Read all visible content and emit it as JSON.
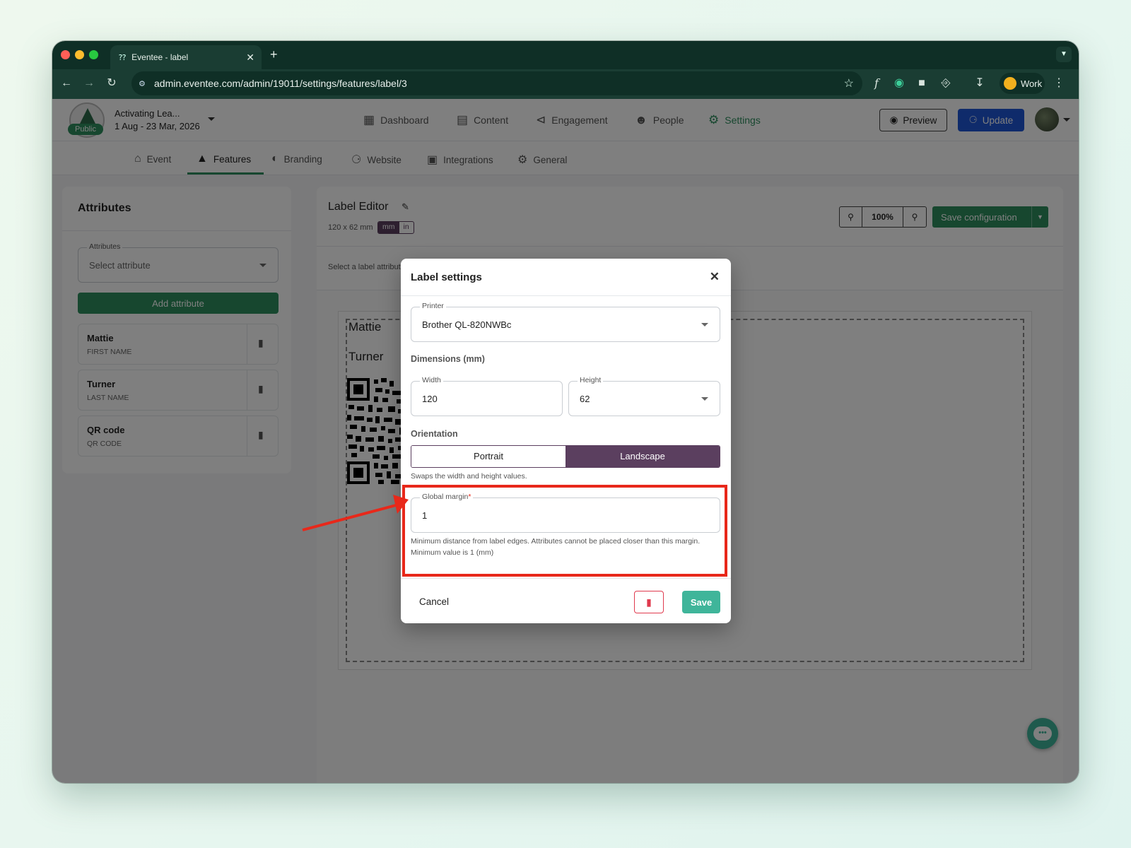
{
  "browser": {
    "tab_title": "Eventee - label",
    "url": "admin.eventee.com/admin/19011/settings/features/label/3",
    "profile_label": "Work"
  },
  "event": {
    "name": "Activating Lea...",
    "dates": "1 Aug - 23 Mar, 2026",
    "status_badge": "Public"
  },
  "main_nav": {
    "items": [
      {
        "label": "Dashboard",
        "icon": "dashboard-icon"
      },
      {
        "label": "Content",
        "icon": "calendar-icon"
      },
      {
        "label": "Engagement",
        "icon": "share-icon"
      },
      {
        "label": "People",
        "icon": "people-icon"
      },
      {
        "label": "Settings",
        "icon": "gear-icon",
        "active": true
      }
    ],
    "preview_label": "Preview",
    "update_label": "Update"
  },
  "sub_nav": {
    "items": [
      {
        "label": "Event",
        "icon": "home-icon"
      },
      {
        "label": "Features",
        "icon": "rocket-icon",
        "active": true
      },
      {
        "label": "Branding",
        "icon": "palette-icon"
      },
      {
        "label": "Website",
        "icon": "globe-icon"
      },
      {
        "label": "Integrations",
        "icon": "puzzle-icon"
      },
      {
        "label": "General",
        "icon": "gears-icon"
      }
    ]
  },
  "attributes_panel": {
    "title": "Attributes",
    "select_label": "Attributes",
    "select_placeholder": "Select attribute",
    "add_button": "Add attribute",
    "items": [
      {
        "name": "Mattie",
        "type": "FIRST NAME"
      },
      {
        "name": "Turner",
        "type": "LAST NAME"
      },
      {
        "name": "QR code",
        "type": "QR CODE"
      }
    ]
  },
  "editor": {
    "title": "Label Editor",
    "size": "120 x 62 mm",
    "unit_mm": "mm",
    "unit_in": "in",
    "zoom": "100%",
    "save_config": "Save configuration",
    "hint": "Select a label attribute",
    "canvas_lines": [
      "Mattie",
      "Turner"
    ]
  },
  "modal": {
    "title": "Label settings",
    "printer_label": "Printer",
    "printer_value": "Brother QL-820NWBc",
    "dimensions_title": "Dimensions (mm)",
    "width_label": "Width",
    "width_value": "120",
    "height_label": "Height",
    "height_value": "62",
    "orientation_title": "Orientation",
    "portrait": "Portrait",
    "landscape": "Landscape",
    "orientation_help": "Swaps the width and height values.",
    "margin_label": "Global margin",
    "margin_required": "*",
    "margin_value": "1",
    "margin_help_1": "Minimum distance from label edges. Attributes cannot be placed closer than this margin.",
    "margin_help_2": "Minimum value is 1 (mm)",
    "cancel": "Cancel",
    "save": "Save"
  },
  "colors": {
    "browser_dark": "#1a3d33",
    "accent_green": "#2f8f5f",
    "teal_save": "#3fb59a",
    "landscape_purple": "#5b3f5f",
    "update_blue": "#1f56d6",
    "annotation_red": "#e8281a"
  }
}
